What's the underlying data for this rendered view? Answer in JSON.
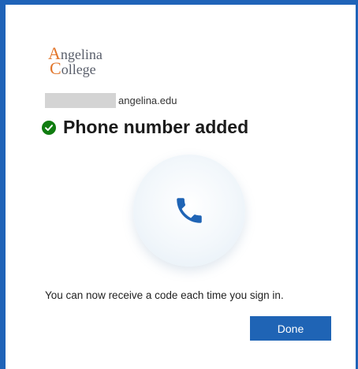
{
  "logo": {
    "line1_initial": "A",
    "line1_rest": "ngelina",
    "line2_initial": "C",
    "line2_rest": "ollege"
  },
  "account": {
    "domain": "angelina.edu"
  },
  "header": {
    "title": "Phone number added"
  },
  "main": {
    "message": "You can now receive a code each time you sign in."
  },
  "actions": {
    "done_label": "Done"
  },
  "icons": {
    "status": "check-circle-icon",
    "illustration": "phone-icon"
  },
  "colors": {
    "accent": "#1f63b8",
    "success": "#107c10",
    "logo_orange": "#e2762b"
  }
}
